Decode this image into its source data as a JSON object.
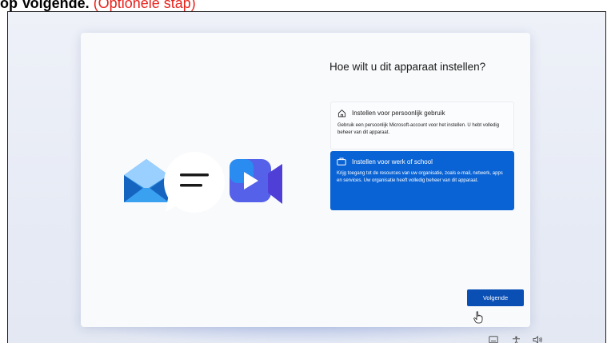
{
  "caption": {
    "bold": "op Volgende.",
    "red": "(Optionele stap)"
  },
  "setup": {
    "heading": "Hoe wilt u dit apparaat instellen?",
    "options": [
      {
        "title": "Instellen voor persoonlijk gebruik",
        "description": "Gebruik een persoonlijk Microsoft-account voor het instellen. U hebt volledig beheer van dit apparaat.",
        "icon": "home-icon",
        "selected": false
      },
      {
        "title": "Instellen voor werk of school",
        "description": "Krijg toegang tot de resources van uw organisatie, zoals e-mail, netwerk, apps en services. Uw organisatie heeft volledig beheer van dit apparaat.",
        "icon": "briefcase-icon",
        "selected": true
      }
    ],
    "next_label": "Volgende"
  },
  "tray": {
    "icons": [
      "keyboard-icon",
      "accessibility-icon",
      "volume-icon"
    ]
  },
  "colors": {
    "selected": "#0a63d4",
    "button": "#0a4fb4",
    "caption_red": "#e8221c"
  }
}
